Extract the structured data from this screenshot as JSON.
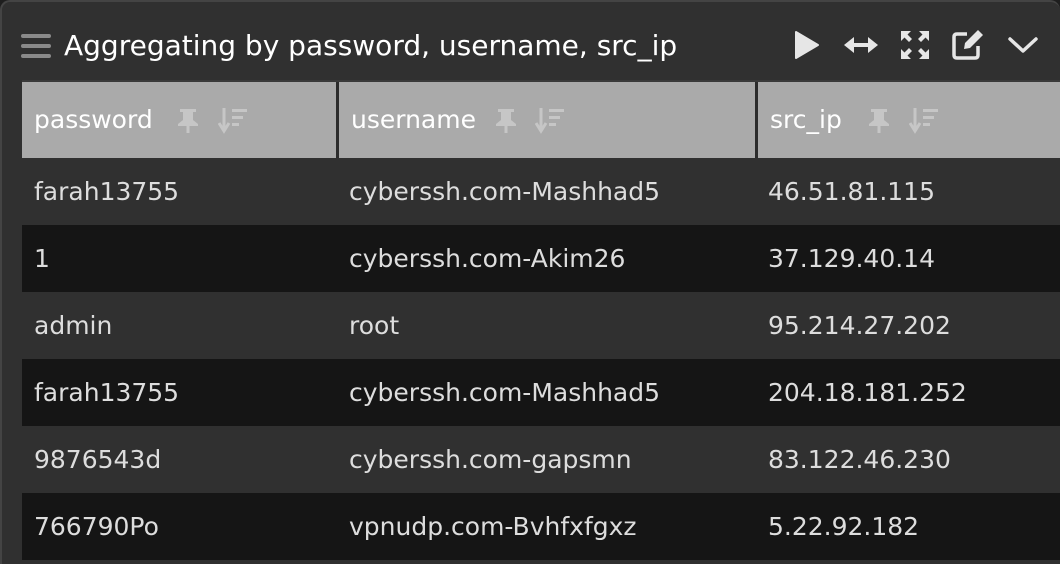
{
  "panel": {
    "title": "Aggregating by password, username, src_ip",
    "menu_icon": "hamburger-icon",
    "toolbar": [
      {
        "name": "run-button",
        "icon": "play-icon"
      },
      {
        "name": "fit-width-button",
        "icon": "horizontal-arrows-icon"
      },
      {
        "name": "fullscreen-button",
        "icon": "expand-icon"
      },
      {
        "name": "edit-button",
        "icon": "edit-icon"
      },
      {
        "name": "collapse-button",
        "icon": "chevron-down-icon"
      }
    ]
  },
  "table": {
    "columns": [
      {
        "label": "password",
        "pin_icon": "pin-icon",
        "sort_icon": "sort-icon"
      },
      {
        "label": "username",
        "pin_icon": "pin-icon",
        "sort_icon": "sort-icon"
      },
      {
        "label": "src_ip",
        "pin_icon": "pin-icon",
        "sort_icon": "sort-icon"
      }
    ],
    "rows": [
      [
        "farah13755",
        "cyberssh.com-Mashhad5",
        "46.51.81.115"
      ],
      [
        "1",
        "cyberssh.com-Akim26",
        "37.129.40.14"
      ],
      [
        "admin",
        "root",
        "95.214.27.202"
      ],
      [
        "farah13755",
        "cyberssh.com-Mashhad5",
        "204.18.181.252"
      ],
      [
        "9876543d",
        "cyberssh.com-gapsmn",
        "83.122.46.230"
      ],
      [
        "766790Po",
        "vpnudp.com-Bvhfxfgxz",
        "5.22.92.182"
      ]
    ]
  },
  "colors": {
    "panel_bg": "#303030",
    "header_row_bg": "#aaaaaa",
    "stripe_dark": "#151515",
    "text": "#dddddd"
  }
}
